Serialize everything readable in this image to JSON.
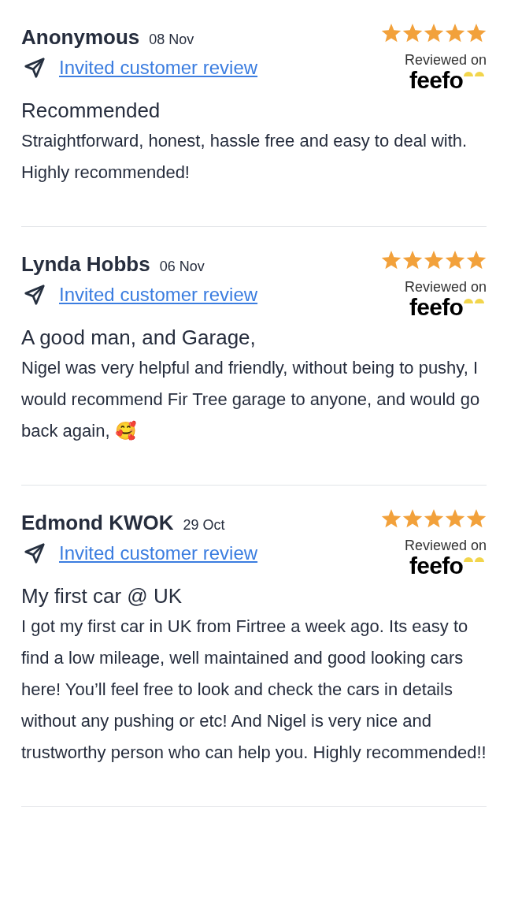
{
  "reviews": [
    {
      "name": "Anonymous",
      "date": "08 Nov",
      "link": "Invited customer review",
      "stars": 5,
      "badge": "Reviewed on",
      "logo": "feefo",
      "title": "Recommended",
      "body": "Straightforward, honest, hassle free and easy to deal with. Highly recommended!"
    },
    {
      "name": "Lynda Hobbs",
      "date": "06 Nov",
      "link": "Invited customer review",
      "stars": 5,
      "badge": "Reviewed on",
      "logo": "feefo",
      "title": "A good man, and Garage,",
      "body": "Nigel was very helpful and friendly, without being to pushy, I would recommend Fir Tree garage to anyone, and would go back again, 🥰"
    },
    {
      "name": "Edmond KWOK",
      "date": "29 Oct",
      "link": "Invited customer review",
      "stars": 5,
      "badge": "Reviewed on",
      "logo": "feefo",
      "title": "My first car @ UK",
      "body": "I got my first car in UK from Firtree a week ago. Its easy to find a low mileage, well maintained and good looking cars here! You’ll feel free to look and check the cars in details without any pushing or etc! And Nigel is very nice and trustworthy person who can help you. Highly recommended!!"
    }
  ]
}
